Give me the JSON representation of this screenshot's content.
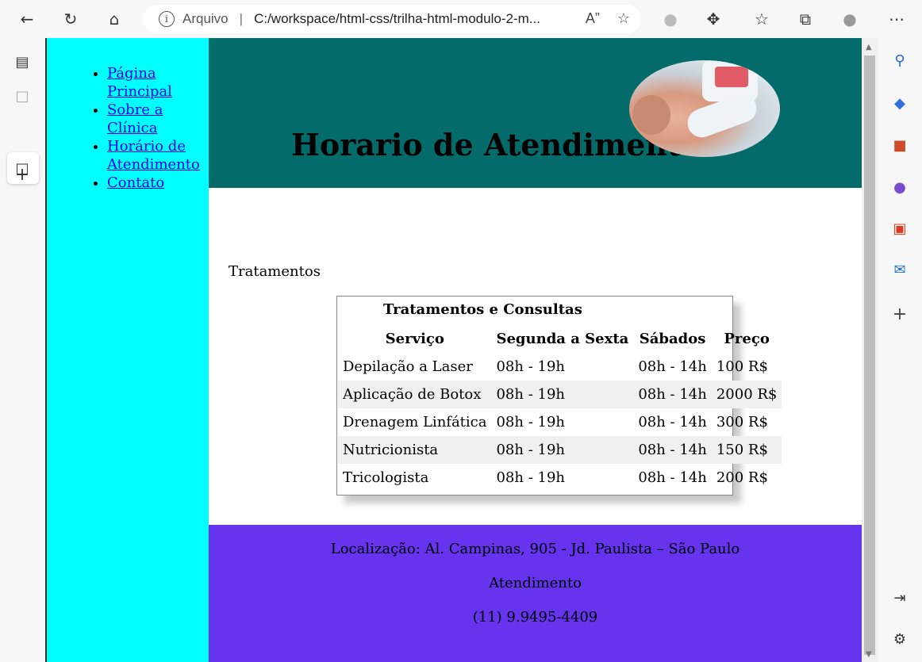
{
  "browser": {
    "address_prefix": "Arquivo",
    "address_separator": "|",
    "url": "C:/workspace/html-css/trilha-html-modulo-2-m..."
  },
  "nav": {
    "items": [
      {
        "label": "Página Principal"
      },
      {
        "label": "Sobre a Clínica"
      },
      {
        "label": "Horário de Atendimento"
      },
      {
        "label": "Contato"
      }
    ]
  },
  "header": {
    "title": "Horario de Atendimento"
  },
  "section": {
    "title": "Tratamentos"
  },
  "table": {
    "caption": "Tratamentos e Consultas",
    "headers": [
      "Serviço",
      "Segunda a Sexta",
      "Sábados",
      "Preço"
    ],
    "rows": [
      [
        "Depilação a Laser",
        "08h - 19h",
        "08h - 14h",
        "100 R$"
      ],
      [
        "Aplicação de Botox",
        "08h - 19h",
        "08h - 14h",
        "2000 R$"
      ],
      [
        "Drenagem Linfática",
        "08h - 19h",
        "08h - 14h",
        "300 R$"
      ],
      [
        "Nutricionista",
        "08h - 19h",
        "08h - 14h",
        "150 R$"
      ],
      [
        "Tricologista",
        "08h - 19h",
        "08h - 14h",
        "200 R$"
      ]
    ]
  },
  "footer": {
    "location": "Localização: Al. Campinas, 905 - Jd. Paulista – São Paulo",
    "hours_label": "Atendimento",
    "phone": "(11) 9.9495-4409"
  },
  "colors": {
    "nav_bg": "#00ffff",
    "header_bg": "#036b6a",
    "footer_bg": "#6633ee"
  }
}
